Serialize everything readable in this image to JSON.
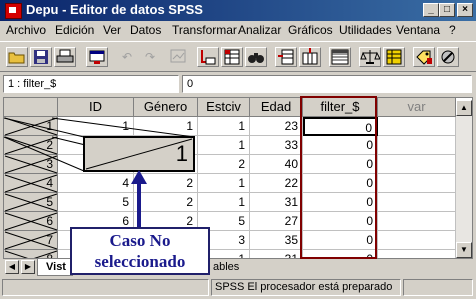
{
  "window": {
    "title": "Depu - Editor de datos SPSS",
    "minimize_icon": "minimize-icon",
    "maximize_icon": "maximize-icon",
    "close_icon": "close-icon"
  },
  "menu": [
    "Archivo",
    "Edición",
    "Ver",
    "Datos",
    "Transformar",
    "Analizar",
    "Gráficos",
    "Utilidades",
    "Ventana",
    "?"
  ],
  "toolbar": {
    "icons": [
      "open-file-icon",
      "save-icon",
      "print-icon",
      "dialog-recall-icon",
      "undo-icon",
      "redo-icon",
      "chart-icon",
      "goto-case-icon",
      "variables-icon",
      "find-icon",
      "insert-case-icon",
      "insert-variable-icon",
      "split-file-icon",
      "weight-cases-icon",
      "select-cases-icon",
      "value-labels-icon",
      "use-sets-icon"
    ]
  },
  "cell_editor": {
    "cell_ref": "1 : filter_$",
    "cell_value": "0"
  },
  "grid": {
    "columns": [
      "ID",
      "Género",
      "Estciv",
      "Edad",
      "filter_$",
      "var"
    ],
    "rows": [
      {
        "num": "1",
        "values": [
          "1",
          "1",
          "1",
          "23",
          "0"
        ]
      },
      {
        "num": "2",
        "values": [
          "2",
          "",
          "1",
          "33",
          "0"
        ]
      },
      {
        "num": "3",
        "values": [
          "3",
          "",
          "2",
          "40",
          "0"
        ]
      },
      {
        "num": "4",
        "values": [
          "4",
          "2",
          "1",
          "22",
          "0"
        ]
      },
      {
        "num": "5",
        "values": [
          "5",
          "2",
          "1",
          "31",
          "0"
        ]
      },
      {
        "num": "6",
        "values": [
          "6",
          "2",
          "5",
          "27",
          "0"
        ]
      },
      {
        "num": "7",
        "values": [
          "7",
          "",
          "3",
          "35",
          "0"
        ]
      },
      {
        "num": "8",
        "values": [
          "",
          "",
          "1",
          "31",
          "0"
        ]
      }
    ],
    "zoom_value": "1"
  },
  "tabs": {
    "data_view": "Vist",
    "variable_view": "ables"
  },
  "callout": {
    "line1": "Caso No",
    "line2": "seleccionado"
  },
  "status": {
    "processor": "SPSS  El procesador  está preparado"
  },
  "colors": {
    "titlebar_start": "#0a246a",
    "titlebar_end": "#3a6ea5",
    "highlight": "#800000",
    "callout_text": "#1a1a8c",
    "arrow": "#1a1a8c"
  }
}
